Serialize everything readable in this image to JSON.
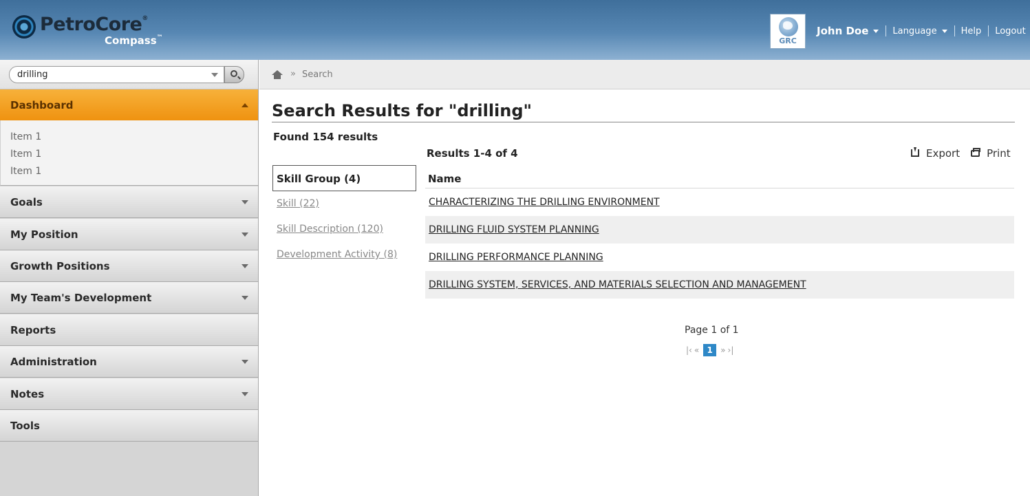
{
  "brand": {
    "name": "PetroCore",
    "registered_mark": "®",
    "product": "Compass",
    "trademark": "™",
    "partner_badge": "GRC"
  },
  "topnav": {
    "user_name": "John Doe",
    "language_label": "Language",
    "help_label": "Help",
    "logout_label": "Logout"
  },
  "search": {
    "value": "drilling"
  },
  "sidebar": {
    "items": [
      {
        "label": "Dashboard",
        "expanded": true,
        "has_menu": true
      },
      {
        "label": "Goals",
        "has_menu": true
      },
      {
        "label": "My Position",
        "has_menu": true
      },
      {
        "label": "Growth Positions",
        "has_menu": true
      },
      {
        "label": "My Team's Development",
        "has_menu": true
      },
      {
        "label": "Reports",
        "has_menu": false
      },
      {
        "label": "Administration",
        "has_menu": true
      },
      {
        "label": "Notes",
        "has_menu": true
      },
      {
        "label": "Tools",
        "has_menu": false
      }
    ],
    "dashboard_subitems": [
      "Item 1",
      "Item 1",
      "Item 1"
    ]
  },
  "breadcrumb": {
    "separator": "»",
    "current": "Search"
  },
  "main": {
    "title": "Search Results for \"drilling\"",
    "found": "Found 154 results",
    "facets": [
      {
        "label": "Skill Group (4)",
        "active": true
      },
      {
        "label": "Skill (22)",
        "active": false
      },
      {
        "label": "Skill Description (120)",
        "active": false
      },
      {
        "label": "Development Activity (8)",
        "active": false
      }
    ],
    "results_summary": "Results 1-4 of 4",
    "export_label": "Export",
    "print_label": "Print",
    "column_header": "Name",
    "rows": [
      "CHARACTERIZING THE DRILLING ENVIRONMENT",
      "DRILLING FLUID SYSTEM PLANNING",
      "DRILLING PERFORMANCE PLANNING",
      "DRILLING SYSTEM, SERVICES, AND MATERIALS SELECTION AND MANAGEMENT"
    ],
    "pager": {
      "label": "Page 1 of 1",
      "first": "|‹",
      "prev": "«",
      "current": "1",
      "next": "»",
      "last": "›|"
    }
  },
  "colors": {
    "header_top": "#3f6f9b",
    "active_nav": "#ef9210",
    "pager_current": "#2e88c7"
  }
}
